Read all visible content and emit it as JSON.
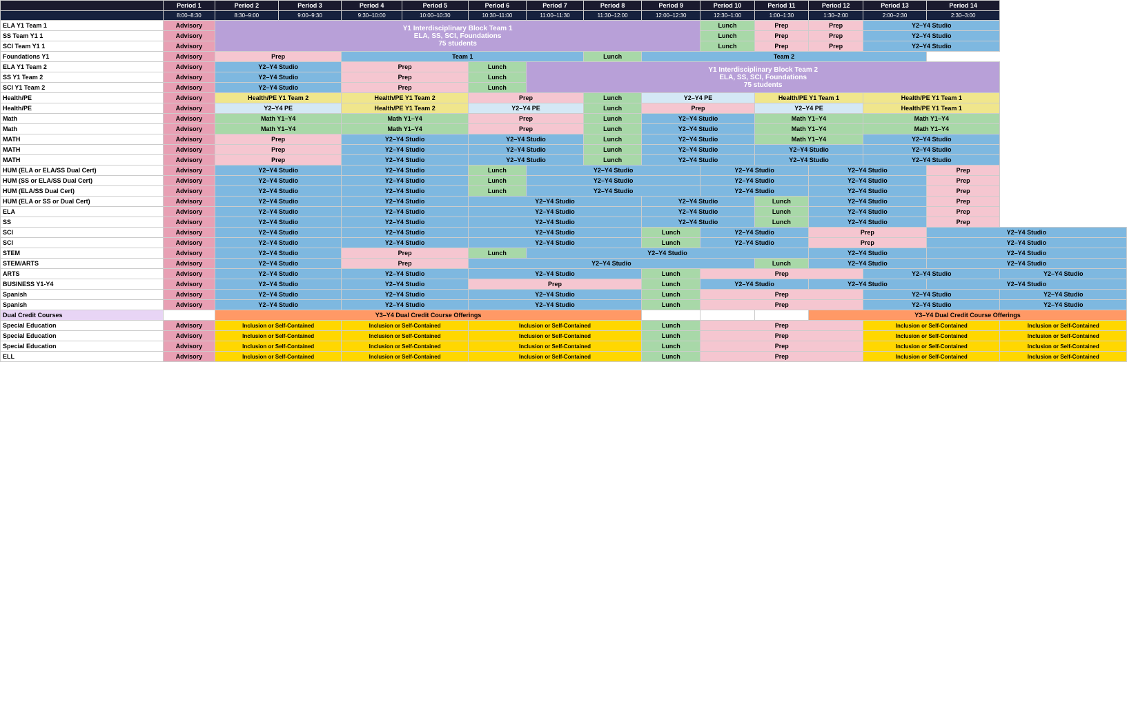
{
  "headers": {
    "periods": [
      {
        "label": "Period 1",
        "time": "8:00–8:30"
      },
      {
        "label": "Period 2",
        "time": "8:30–9:00"
      },
      {
        "label": "Period 3",
        "time": "9:00–9:30"
      },
      {
        "label": "Period 4",
        "time": "9:30–10:00"
      },
      {
        "label": "Period 5",
        "time": "10:00–10:30"
      },
      {
        "label": "Period 6",
        "time": "10:30–11:00"
      },
      {
        "label": "Period 7",
        "time": "11:00–11:30"
      },
      {
        "label": "Period 8",
        "time": "11:30–12:00"
      },
      {
        "label": "Period 9",
        "time": "12:00–12:30"
      },
      {
        "label": "Period 10",
        "time": "12:30–1:00"
      },
      {
        "label": "Period 11",
        "time": "1:00–1:30"
      },
      {
        "label": "Period 12",
        "time": "1:30–2:00"
      },
      {
        "label": "Period 13",
        "time": "2:00–2:30"
      },
      {
        "label": "Period 14",
        "time": "2:30–3:00"
      }
    ]
  },
  "rows": [
    {
      "label": "ELA Y1 Team 1"
    },
    {
      "label": "SS Team Y1 1"
    },
    {
      "label": "SCI Team Y1 1"
    },
    {
      "label": "Foundations Y1"
    },
    {
      "label": "ELA Y1 Team 2"
    },
    {
      "label": "SS Y1 Team 2"
    },
    {
      "label": "SCI Y1 Team 2"
    },
    {
      "label": "Health/PE"
    },
    {
      "label": "Health/PE"
    },
    {
      "label": "Math"
    },
    {
      "label": "Math"
    },
    {
      "label": "MATH"
    },
    {
      "label": "MATH"
    },
    {
      "label": "MATH"
    },
    {
      "label": "HUM (ELA or ELA/SS Dual Cert)"
    },
    {
      "label": "HUM (SS or ELA/SS Dual Cert)"
    },
    {
      "label": "HUM (ELA/SS Dual Cert)"
    },
    {
      "label": "HUM (ELA or SS or Dual Cert)"
    },
    {
      "label": "ELA"
    },
    {
      "label": "SS"
    },
    {
      "label": "SCI"
    },
    {
      "label": "SCI"
    },
    {
      "label": "STEM"
    },
    {
      "label": "STEM/ARTS"
    },
    {
      "label": "ARTS"
    },
    {
      "label": "BUSINESS Y1-Y4"
    },
    {
      "label": "Spanish"
    },
    {
      "label": "Spanish"
    },
    {
      "label": "Dual Credit Courses"
    },
    {
      "label": "Special Education"
    },
    {
      "label": "Special Education"
    },
    {
      "label": "Special Education"
    },
    {
      "label": "ELL"
    }
  ],
  "labels": {
    "advisory": "Advisory",
    "lunch": "Lunch",
    "prep": "Prep",
    "y2y4studio": "Y2–Y4 Studio",
    "mathy1y4": "Math Y1–Y4",
    "interdisciplinary1": "Y1 Interdisciplinary Block Team 1",
    "interdisciplinary1sub": "ELA, SS, SCI, Foundations",
    "interdisciplinary1students": "75 students",
    "interdisciplinary2": "Y1 Interdisciplinary Block Team 2",
    "interdisciplinary2sub": "ELA, SS, SCI, Foundations",
    "interdisciplinary2students": "75 students",
    "team1": "Team 1",
    "team2": "Team 2",
    "healthpe_y1team2": "Health/PE Y1 Team 2",
    "healthpe_y1team1": "Health/PE Y1 Team 1",
    "y2y4pe": "Y2–Y4 PE",
    "dual_credit": "Y3–Y4 Dual Credit Course Offerings",
    "inclusion": "Inclusion or Self-Contained"
  }
}
